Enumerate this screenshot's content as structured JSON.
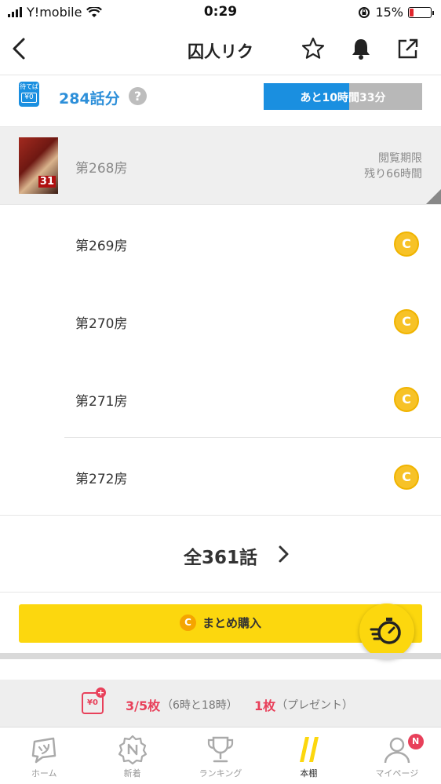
{
  "status_bar": {
    "carrier": "Y!mobile",
    "time": "0:29",
    "battery": "15%"
  },
  "nav": {
    "title": "囚人リク"
  },
  "wait_free": {
    "badge_top": "待てば",
    "badge_price": "¥0",
    "count": "284話分",
    "help": "?",
    "timer_text": "あと10時間33分",
    "timer_progress": 0.54
  },
  "episodes": [
    {
      "name": "第268房",
      "limit_line1": "閲覧期限",
      "limit_line2": "残り66時間",
      "volume": "31"
    },
    {
      "name": "第269房",
      "coin": "C"
    },
    {
      "name": "第270房",
      "coin": "C"
    },
    {
      "name": "第271房",
      "coin": "C"
    },
    {
      "name": "第272房",
      "coin": "C"
    }
  ],
  "all_episodes": {
    "label": "全361話"
  },
  "bulk": {
    "coin": "C",
    "label": "まとめ購入"
  },
  "ticket": {
    "icon": "¥0",
    "count": "3/5枚",
    "note": "（6時と18時）",
    "present_count": "1枚",
    "present_note": "（プレゼント）"
  },
  "tabbar": [
    {
      "label": "ホーム"
    },
    {
      "label": "新着"
    },
    {
      "label": "ランキング"
    },
    {
      "label": "本棚"
    },
    {
      "label": "マイページ",
      "badge": "N"
    }
  ],
  "colors": {
    "accent_blue": "#1a8fe0",
    "brand_yellow": "#fcd70e",
    "coin_gold": "#f7c227",
    "alert_pink": "#e8405a"
  }
}
